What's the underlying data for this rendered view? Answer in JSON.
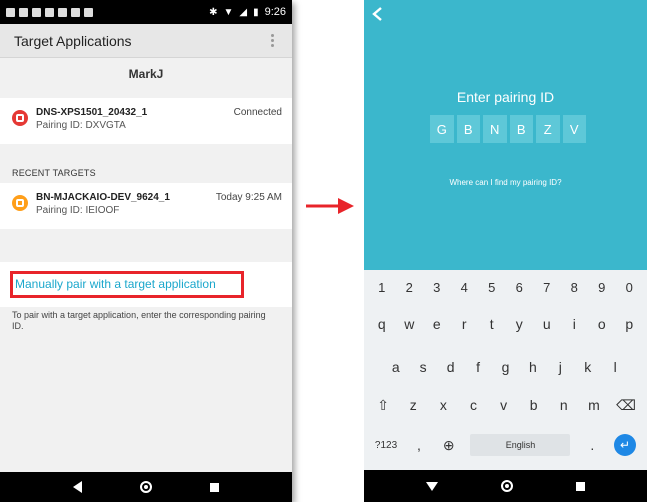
{
  "left_phone": {
    "status_time": "9:26",
    "app_title": "Target Applications",
    "user_name": "MarkJ",
    "current_target": {
      "name": "DNS-XPS1501_20432_1",
      "pairing": "Pairing ID: DXVGTA",
      "status": "Connected",
      "icon": "app-target-icon",
      "icon_color": "#e53935"
    },
    "recent_label": "RECENT TARGETS",
    "recent_target": {
      "name": "BN-MJACKAIO-DEV_9624_1",
      "pairing": "Pairing ID: IEIOOF",
      "status": "Today 9:25 AM",
      "icon": "app-target-icon",
      "icon_color": "#ff9f1a"
    },
    "manual_link": "Manually pair with a target application",
    "manual_help": "To pair with a target application, enter the corresponding pairing ID."
  },
  "right_phone": {
    "title": "Enter pairing ID",
    "codes": [
      "G",
      "B",
      "N",
      "B",
      "Z",
      "V"
    ],
    "help_link": "Where can I find my pairing ID?",
    "panel_color": "#3bb7cc",
    "keyboard": {
      "numbers": [
        "1",
        "2",
        "3",
        "4",
        "5",
        "6",
        "7",
        "8",
        "9",
        "0"
      ],
      "row1": [
        "q",
        "w",
        "e",
        "r",
        "t",
        "y",
        "u",
        "i",
        "o",
        "p"
      ],
      "row2": [
        "a",
        "s",
        "d",
        "f",
        "g",
        "h",
        "j",
        "k",
        "l"
      ],
      "row3": [
        "z",
        "x",
        "c",
        "v",
        "b",
        "n",
        "m"
      ],
      "symbols": "?123",
      "comma": ",",
      "space": "English",
      "period": "."
    }
  },
  "accent_red": "#e8242a",
  "link_color": "#1ba7cc"
}
